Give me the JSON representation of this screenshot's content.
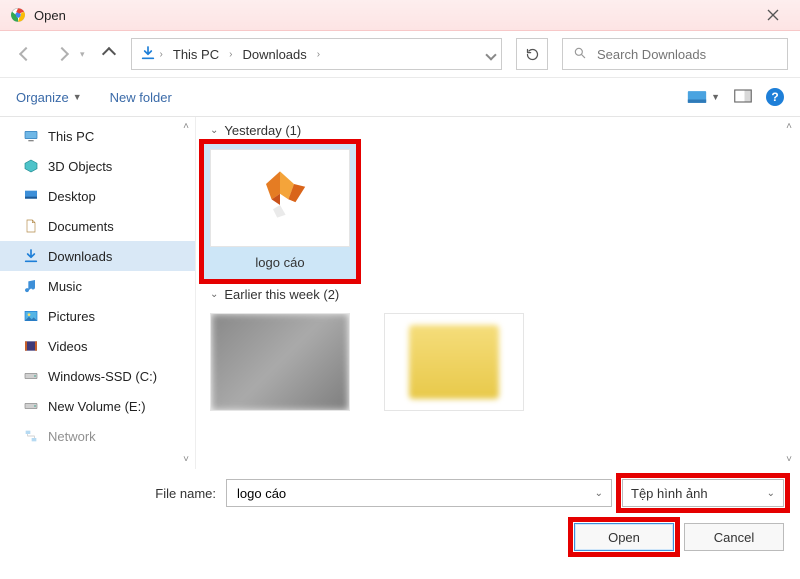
{
  "titlebar": {
    "title": "Open"
  },
  "nav": {
    "path_segments": [
      "This PC",
      "Downloads"
    ],
    "search_placeholder": "Search Downloads"
  },
  "toolbar": {
    "organize": "Organize",
    "new_folder": "New folder"
  },
  "sidebar": {
    "items": [
      {
        "label": "This PC",
        "icon": "pc"
      },
      {
        "label": "3D Objects",
        "icon": "3d"
      },
      {
        "label": "Desktop",
        "icon": "desktop"
      },
      {
        "label": "Documents",
        "icon": "documents"
      },
      {
        "label": "Downloads",
        "icon": "downloads",
        "selected": true
      },
      {
        "label": "Music",
        "icon": "music"
      },
      {
        "label": "Pictures",
        "icon": "pictures"
      },
      {
        "label": "Videos",
        "icon": "videos"
      },
      {
        "label": "Windows-SSD (C:)",
        "icon": "drive"
      },
      {
        "label": "New Volume (E:)",
        "icon": "drive"
      },
      {
        "label": "Network",
        "icon": "network",
        "faded": true
      }
    ]
  },
  "content": {
    "groups": [
      {
        "header": "Yesterday (1)",
        "items": [
          {
            "name": "logo cáo",
            "selected": true,
            "highlight": true,
            "kind": "fox-image"
          }
        ]
      },
      {
        "header": "Earlier this week (2)",
        "items": [
          {
            "name": "",
            "kind": "blur"
          },
          {
            "name": "",
            "kind": "folder-blur"
          }
        ]
      }
    ]
  },
  "bottom": {
    "file_name_label": "File name:",
    "file_name_value": "logo cáo",
    "file_type_value": "Tệp hình ảnh",
    "open_label": "Open",
    "cancel_label": "Cancel"
  }
}
